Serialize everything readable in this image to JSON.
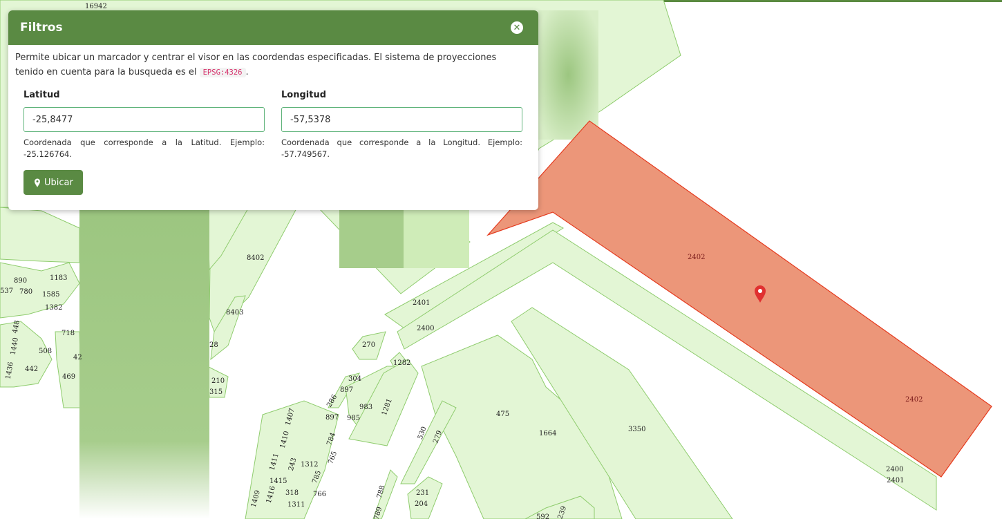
{
  "panel": {
    "title": "Filtros",
    "description_before": "Permite ubicar un marcador y centrar el visor en las coordendas especificadas. El sistema de proyecciones tenido en cuenta para la busqueda es el ",
    "projection_code": "EPSG:4326",
    "description_after": ".",
    "latitude": {
      "label": "Latitud",
      "value": "-25,8477",
      "help": "Coordenada que corresponde a la Latitud. Ejemplo: -25.126764."
    },
    "longitude": {
      "label": "Longitud",
      "value": "-57,5378",
      "help": "Coordenada que corresponde a la Longitud. Ejemplo: -57.749567."
    },
    "locate_button": "Ubicar"
  },
  "map": {
    "parcel_labels": {
      "l16942": "16942",
      "l8402": "8402",
      "l8403": "8403",
      "l2401a": "2401",
      "l2400a": "2400",
      "l2402a": "2402",
      "l2402b": "2402",
      "l2400b": "2400",
      "l2401b": "2401",
      "l270": "270",
      "l1282": "1282",
      "l304": "304",
      "l897a": "897",
      "l286": "286",
      "l897b": "897",
      "l985": "985",
      "l983": "983",
      "l1281": "1281",
      "l475": "475",
      "l1664": "1664",
      "l3350": "3350",
      "l530": "530",
      "l279": "279",
      "l231": "231",
      "l204": "204",
      "l789": "789",
      "l788": "788",
      "l1407": "1407",
      "l1410": "1410",
      "l1411": "1411",
      "l243": "243",
      "l1312": "1312",
      "l784": "784",
      "l765": "765",
      "l1415": "1415",
      "l785": "785",
      "l318": "318",
      "l766": "766",
      "l1416": "1416",
      "l1409": "1409",
      "l1311": "1311",
      "l890": "890",
      "l1183": "1183",
      "l537": "537",
      "l780": "780",
      "l1585": "1585",
      "l1382": "1382",
      "l718": "718",
      "l448": "448",
      "l1440": "1440",
      "l508": "508",
      "l442": "442",
      "l469": "469",
      "l1436": "1436",
      "l28": "28",
      "l210": "210",
      "l315": "315",
      "l42": "42",
      "l592": "592",
      "l239": "239"
    },
    "colors": {
      "parcel_fill": "#e3f6d5",
      "parcel_stroke": "#8fcc6e",
      "selected_fill": "#ec9679",
      "selected_stroke": "#e53b1f",
      "marker": "#e03030",
      "accent": "#5a8a43"
    }
  }
}
